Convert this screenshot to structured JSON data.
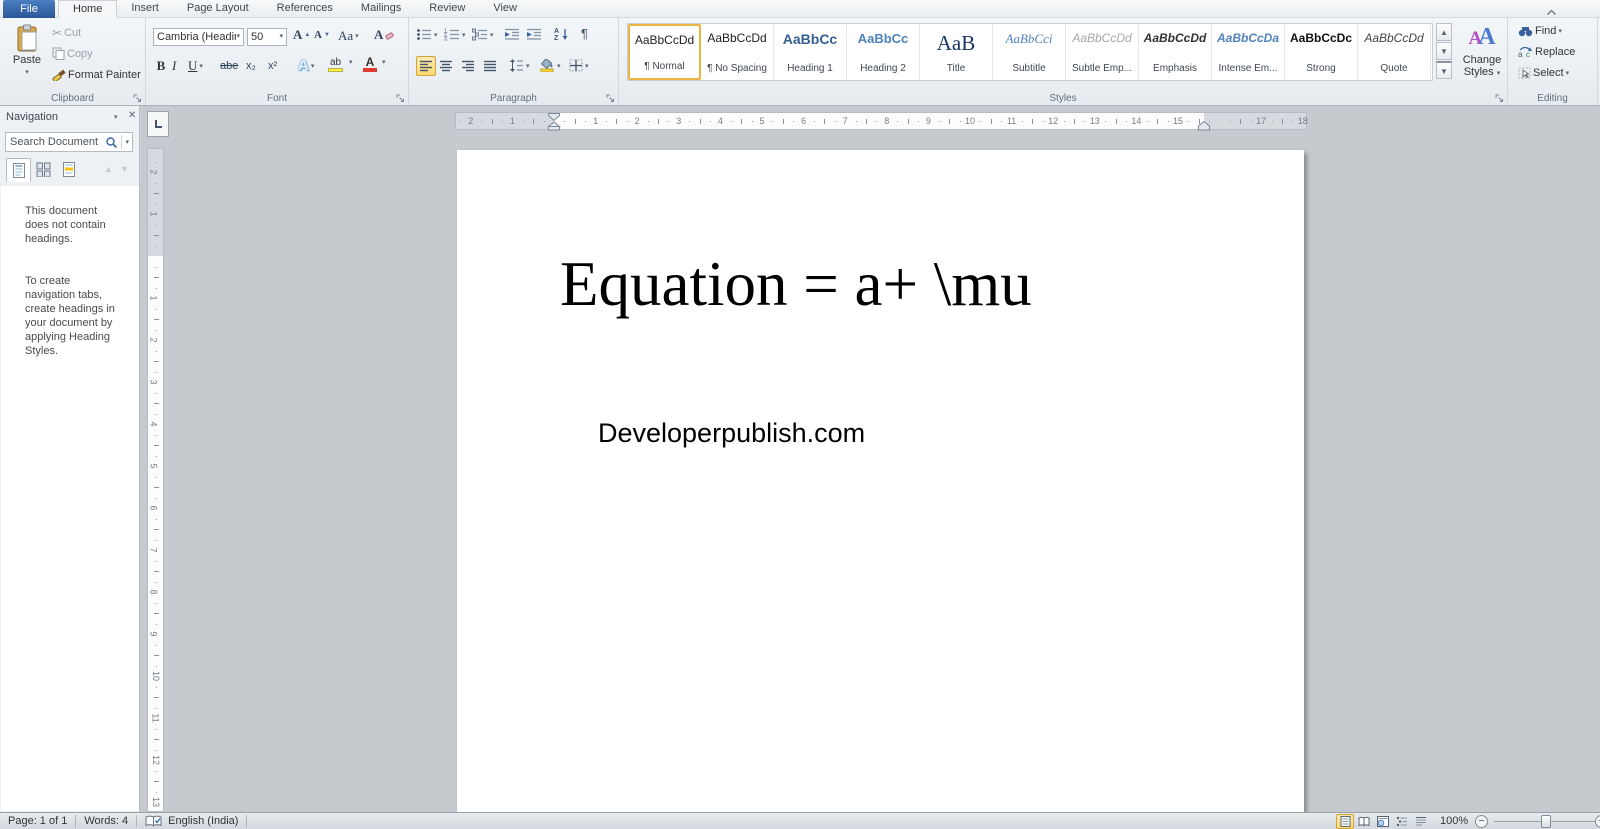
{
  "window": {
    "minimize_ribbon_icon": "chevron-up"
  },
  "tabs": {
    "file": "File",
    "items": [
      "Home",
      "Insert",
      "Page Layout",
      "References",
      "Mailings",
      "Review",
      "View"
    ],
    "active": "Home"
  },
  "ribbon": {
    "clipboard": {
      "label": "Clipboard",
      "paste": "Paste",
      "cut": "Cut",
      "copy": "Copy",
      "format_painter": "Format Painter"
    },
    "font": {
      "label": "Font",
      "family": "Cambria (Headin",
      "size": "50",
      "bold": "B",
      "italic": "I",
      "underline": "U",
      "strikethrough": "abe",
      "subscript": "x₂",
      "superscript": "x²",
      "change_case": "Aa",
      "grow": "A",
      "shrink": "A",
      "effects": "A",
      "highlight": "ab",
      "color": "A"
    },
    "paragraph": {
      "label": "Paragraph",
      "pilcrow": "¶"
    },
    "styles": {
      "label": "Styles",
      "items": [
        {
          "sample": "AaBbCcDd",
          "label": "¶ Normal",
          "class": "normal",
          "selected": true
        },
        {
          "sample": "AaBbCcDd",
          "label": "¶ No Spacing",
          "class": "nospacing",
          "selected": false
        },
        {
          "sample": "AaBbCc",
          "label": "Heading 1",
          "class": "h1",
          "selected": false
        },
        {
          "sample": "AaBbCc",
          "label": "Heading 2",
          "class": "h2",
          "selected": false
        },
        {
          "sample": "AaB",
          "label": "Title",
          "class": "title",
          "selected": false
        },
        {
          "sample": "AaBbCci",
          "label": "Subtitle",
          "class": "subtitle",
          "selected": false
        },
        {
          "sample": "AaBbCcDd",
          "label": "Subtle Emp...",
          "class": "subtle",
          "selected": false
        },
        {
          "sample": "AaBbCcDd",
          "label": "Emphasis",
          "class": "emphasis",
          "selected": false
        },
        {
          "sample": "AaBbCcDa",
          "label": "Intense Em...",
          "class": "intense",
          "selected": false
        },
        {
          "sample": "AaBbCcDc",
          "label": "Strong",
          "class": "strong",
          "selected": false
        },
        {
          "sample": "AaBbCcDd",
          "label": "Quote",
          "class": "quote",
          "selected": false
        }
      ],
      "change_styles_line1": "Change",
      "change_styles_line2": "Styles"
    },
    "editing": {
      "label": "Editing",
      "find": "Find",
      "replace": "Replace",
      "select": "Select"
    }
  },
  "navigation": {
    "title": "Navigation",
    "search_placeholder": "Search Document",
    "message_lines_1": [
      "This document",
      "does not contain",
      "headings."
    ],
    "message_lines_2": [
      "To create",
      "navigation tabs,",
      "create headings in",
      "your document by",
      "applying Heading",
      "Styles."
    ]
  },
  "document": {
    "heading": "Equation = a+ \\mu",
    "body": "Developerpublish.com"
  },
  "rulers": {
    "h_margin_left": [
      "2",
      "1"
    ],
    "h_text": [
      "1",
      "2",
      "3",
      "4",
      "5",
      "6",
      "7",
      "8",
      "9",
      "10",
      "11",
      "12",
      "13",
      "14",
      "15"
    ],
    "h_margin_right": [
      "17",
      "18"
    ],
    "v_margin_top": [
      "2",
      "1"
    ],
    "v_text": [
      "1",
      "2",
      "3",
      "4",
      "5",
      "6",
      "7",
      "8",
      "9",
      "10",
      "11",
      "12",
      "13"
    ]
  },
  "status": {
    "page": "Page: 1 of 1",
    "words": "Words: 4",
    "language": "English (India)",
    "zoom_level": "100%"
  },
  "colors": {
    "selection_orange": "#fbd96f",
    "file_tab_blue": "#2b5796",
    "heading1_blue": "#365f91",
    "heading2_blue": "#4f81bd",
    "title_navy": "#17365d",
    "page_background": "#c6c9cd"
  }
}
